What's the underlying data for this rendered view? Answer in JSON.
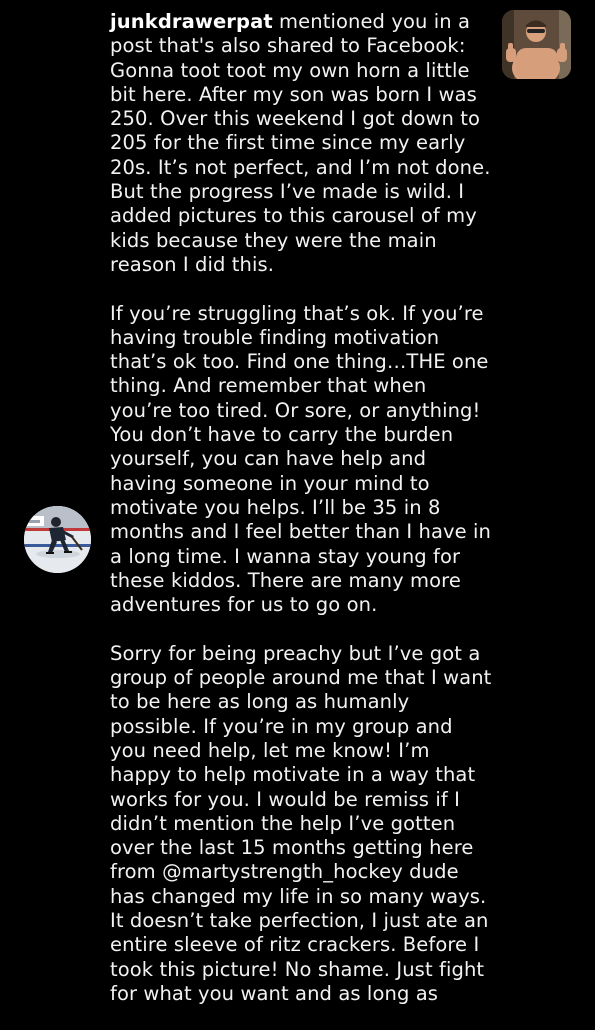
{
  "notification": {
    "username": "junkdrawerpat",
    "action_text": " mentioned you in a post that's also shared to Facebook: ",
    "message_paragraph_1": "Gonna toot toot my own horn a little bit here. After my son was born I was 250. Over this weekend I got down to 205 for the first time since my early 20s. It’s not perfect, and I’m not done. But the progress I’ve made is wild. I added pictures to this carousel of my kids because they were the main reason I did this.",
    "message_paragraph_2": "If you’re struggling that’s ok. If you’re having trouble finding motivation that’s ok too. Find one thing…THE one thing. And remember that when you’re too tired. Or sore, or anything! You don’t have to carry the burden yourself, you can have help and having someone in your mind to motivate you helps. I’ll be 35 in 8 months and I feel better than I have in a long time. I wanna stay young for these kiddos. There are many more adventures for us to go on.",
    "message_paragraph_3": "Sorry for being preachy but I’ve got a group of people around me that I want to be here as long as humanly possible. If you’re in my group and you need help, let me know! I’m happy to help motivate in a way that works for you. I would be remiss if I didn’t mention the help I’ve gotten over the last 15 months getting here from @martystrength_hockey dude has changed my life in so many ways. It doesn’t take perfection, I just ate an entire sleeve of ritz crackers. Before I took this picture! No shame. Just fight for what you want and as long as",
    "avatar_icon": "hockey-player-avatar",
    "thumbnail_icon": "post-thumbnail"
  },
  "colors": {
    "background": "#000000",
    "text": "#f2f2f2",
    "username": "#ffffff"
  }
}
